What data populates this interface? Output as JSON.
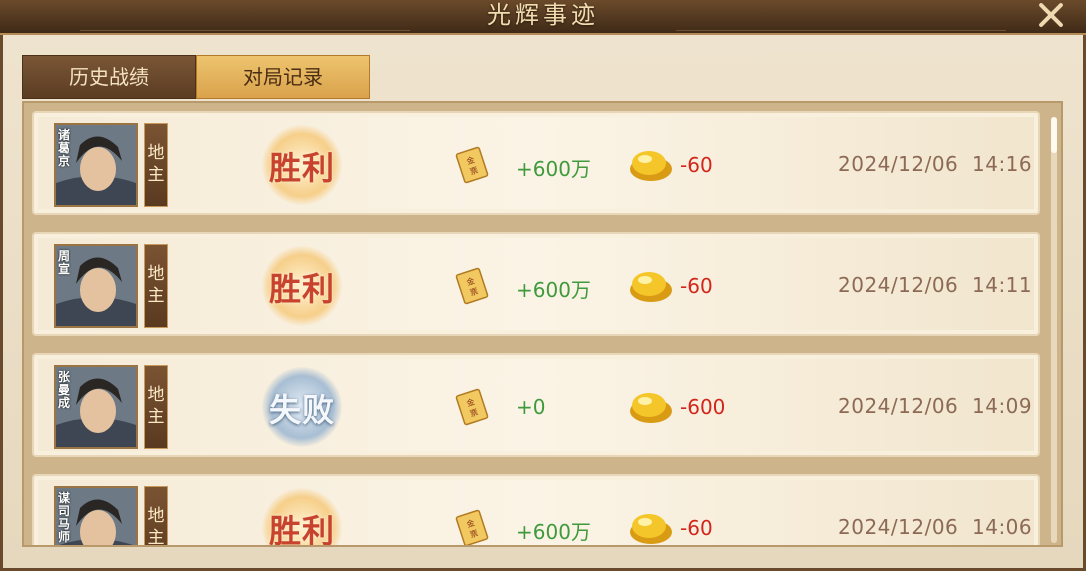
{
  "window": {
    "title": "光辉事迹"
  },
  "tabs": [
    {
      "label": "历史战绩",
      "active": false
    },
    {
      "label": "对局记录",
      "active": true
    }
  ],
  "colors": {
    "win": "#c8432d",
    "lose_badge": "#a8bed3",
    "gold_gain": "#3f9a3c",
    "ingot_loss": "#d2261c"
  },
  "records": [
    {
      "player": "诸葛京",
      "role": "地主",
      "result": "胜利",
      "outcome": "win",
      "gold_icon_text": "金票",
      "gold_change": "+600万",
      "ingot_change": "-60",
      "date": "2024/12/06",
      "time": "14:16"
    },
    {
      "player": "周宣",
      "role": "地主",
      "result": "胜利",
      "outcome": "win",
      "gold_icon_text": "金票",
      "gold_change": "+600万",
      "ingot_change": "-60",
      "date": "2024/12/06",
      "time": "14:11"
    },
    {
      "player": "张曼成",
      "role": "地主",
      "result": "失败",
      "outcome": "lose",
      "gold_icon_text": "金票",
      "gold_change": "+0",
      "ingot_change": "-600",
      "date": "2024/12/06",
      "time": "14:09"
    },
    {
      "player": "谋司马师",
      "role": "地主",
      "result": "胜利",
      "outcome": "win",
      "gold_icon_text": "金票",
      "gold_change": "+600万",
      "ingot_change": "-60",
      "date": "2024/12/06",
      "time": "14:06"
    }
  ]
}
